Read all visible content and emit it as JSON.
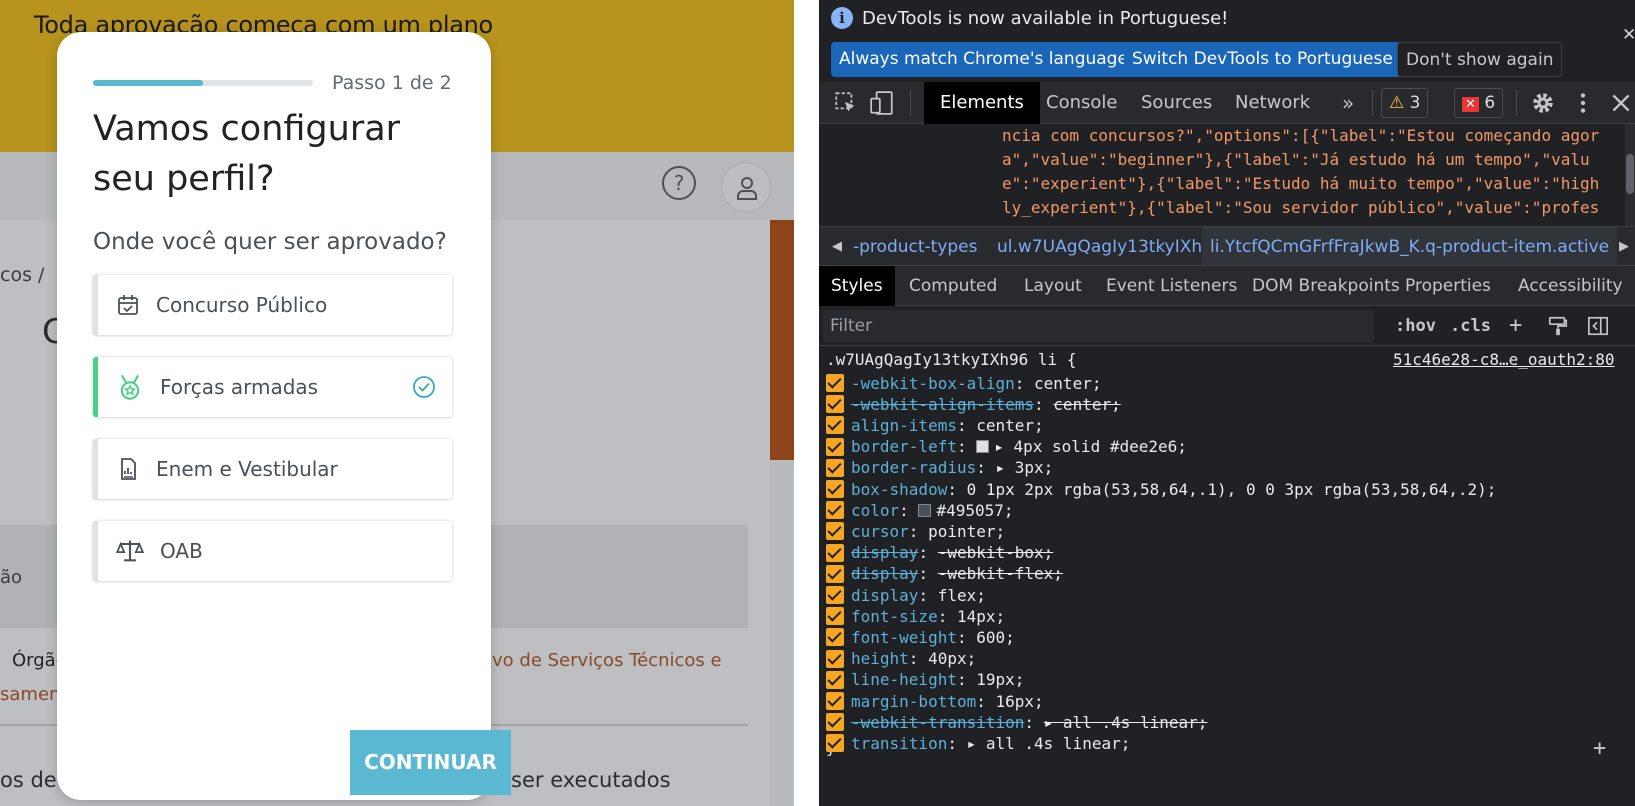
{
  "page": {
    "banner": "Toda aprovação começa com um plano",
    "breadcrumb": "cos /",
    "heading_initial": "C",
    "gray_box_text": "ão",
    "orgao_label": "Órgão",
    "orgao_link": "ivo de Serviços Técnicos e",
    "orgao_link2": "samen",
    "bottom_text_left": "os de p",
    "bottom_text_right": "em ser executados",
    "help_icon": "question-circle-icon",
    "user_icon": "user-icon"
  },
  "modal": {
    "progress": 0.5,
    "step": "Passo 1 de 2",
    "title": "Vamos configurar seu perfil?",
    "question": "Onde você quer ser aprovado?",
    "options": [
      {
        "label": "Concurso Público",
        "icon": "calendar-check-icon",
        "selected": false
      },
      {
        "label": "Forças armadas",
        "icon": "medal-icon",
        "selected": true
      },
      {
        "label": "Enem e Vestibular",
        "icon": "document-chart-icon",
        "selected": false
      },
      {
        "label": "OAB",
        "icon": "scales-icon",
        "selected": false
      }
    ],
    "continue": "CONTINUAR"
  },
  "devtools": {
    "infobar": {
      "text": "DevTools is now available in Portuguese!",
      "btn_match": "Always match Chrome's language",
      "btn_switch": "Switch DevTools to Portuguese",
      "btn_dont": "Don't show again"
    },
    "tabs": [
      "Elements",
      "Console",
      "Sources",
      "Network"
    ],
    "active_tab": "Elements",
    "warnings": "3",
    "errors": "6",
    "html_lines": [
      "ncia com concursos?\",\"options\":[{\"label\":\"Estou começando agor",
      "a\",\"value\":\"beginner\"},{\"label\":\"Já estudo há um tempo\",\"valu",
      "e\":\"experient\"},{\"label\":\"Estudo há muito tempo\",\"value\":\"high",
      "ly_experient\"},{\"label\":\"Sou servidor público\",\"value\":\"profes"
    ],
    "crumbs": [
      "-product-types",
      "ul.w7UAgQagIy13tkyIXh96",
      "li.YtcfQCmGFrfFraJkwB_K.q-product-item.active"
    ],
    "subtabs": [
      "Styles",
      "Computed",
      "Layout",
      "Event Listeners",
      "DOM Breakpoints",
      "Properties",
      "Accessibility"
    ],
    "filter_placeholder": "Filter",
    "hov": ":hov",
    "cls": ".cls",
    "selector": ".w7UAgQagIy13tkyIXh96 li {",
    "source": "51c46e28-c8…e_oauth2:80",
    "declarations": [
      {
        "name": "-webkit-box-align",
        "value": "center;",
        "strike": false
      },
      {
        "name": "-webkit-align-items",
        "value": "center;",
        "strike": true
      },
      {
        "name": "align-items",
        "value": "center;",
        "strike": false
      },
      {
        "name": "border-left",
        "value": "▸ 4px solid #dee2e6;",
        "strike": false,
        "swatch": "#dee2e6"
      },
      {
        "name": "border-radius",
        "value": "▸ 3px;",
        "strike": false
      },
      {
        "name": "box-shadow",
        "value": "0 1px 2px rgba(53,58,64,.1), 0 0 3px rgba(53,58,64,.2);",
        "strike": false
      },
      {
        "name": "color",
        "value": "#495057;",
        "strike": false,
        "swatch": "#495057"
      },
      {
        "name": "cursor",
        "value": "pointer;",
        "strike": false
      },
      {
        "name": "display",
        "value": "-webkit-box;",
        "strike": true
      },
      {
        "name": "display",
        "value": "-webkit-flex;",
        "strike": true
      },
      {
        "name": "display",
        "value": "flex;",
        "strike": false
      },
      {
        "name": "font-size",
        "value": "14px;",
        "strike": false
      },
      {
        "name": "font-weight",
        "value": "600;",
        "strike": false
      },
      {
        "name": "height",
        "value": "40px;",
        "strike": false
      },
      {
        "name": "line-height",
        "value": "19px;",
        "strike": false
      },
      {
        "name": "margin-bottom",
        "value": "16px;",
        "strike": false
      },
      {
        "name": "-webkit-transition",
        "value": "▸ all .4s linear;",
        "strike": true
      },
      {
        "name": "transition",
        "value": "▸ all .4s linear;",
        "strike": false
      }
    ],
    "closing_brace": "}"
  }
}
